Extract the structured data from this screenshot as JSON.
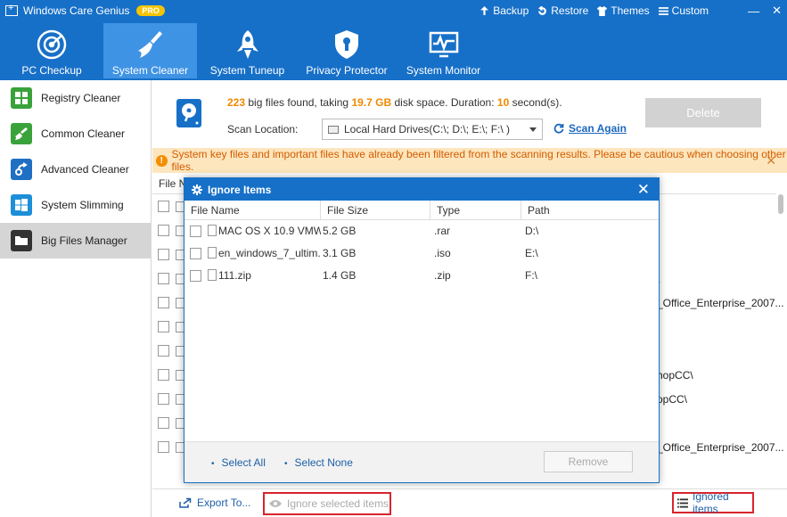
{
  "titlebar": {
    "app_name": "Windows Care Genius",
    "badge": "PRO",
    "actions": [
      "Backup",
      "Restore",
      "Themes",
      "Custom"
    ],
    "minimize": "—",
    "close": "✕"
  },
  "nav": {
    "tabs": [
      {
        "label": "PC Checkup",
        "icon": "radar-icon"
      },
      {
        "label": "System Cleaner",
        "icon": "broom-icon",
        "active": true
      },
      {
        "label": "System Tuneup",
        "icon": "rocket-icon"
      },
      {
        "label": "Privacy Protector",
        "icon": "shield-icon"
      },
      {
        "label": "System Monitor",
        "icon": "monitor-icon"
      }
    ]
  },
  "sidebar": {
    "items": [
      {
        "label": "Registry Cleaner",
        "icon": "registry-icon",
        "color": "#3aa23a"
      },
      {
        "label": "Common Cleaner",
        "icon": "broom-icon",
        "color": "#3aa23a"
      },
      {
        "label": "Advanced Cleaner",
        "icon": "advanced-icon",
        "color": "#1f6fc2"
      },
      {
        "label": "System Slimming",
        "icon": "windows-icon",
        "color": "#1d8fd8"
      },
      {
        "label": "Big Files Manager",
        "icon": "folder-icon",
        "color": "#333333",
        "active": true
      }
    ]
  },
  "scan": {
    "count": "223",
    "text1": " big files found, taking ",
    "size": "19.7 GB",
    "text2": " disk space. Duration: ",
    "duration": "10",
    "text3": " second(s).",
    "location_label": "Scan Location:",
    "location_value": "Local Hard Drives(C:\\; D:\\; E:\\; F:\\ )",
    "scan_again": "Scan Again",
    "delete": "Delete"
  },
  "warning": {
    "text": "System key files and important files have already been filtered from the scanning results. Please be cautious when choosing other files.",
    "close": "✕"
  },
  "bg_table": {
    "header": "File Na",
    "paths": [
      "",
      "",
      "",
      "\\",
      "_Office_Enterprise_2007...",
      "",
      "",
      "hopCC\\",
      "opCC\\",
      "",
      "_Office_Enterprise_2007..."
    ]
  },
  "bottom": {
    "export": "Export To...",
    "ignore_selected": "Ignore selected items",
    "ignored_items": "Ignored items"
  },
  "dialog": {
    "title": "Ignore Items",
    "close": "✕",
    "columns": [
      "File Name",
      "File Size",
      "Type",
      "Path"
    ],
    "rows": [
      {
        "name": "MAC OS X 10.9 VMW...",
        "size": "5.2 GB",
        "type": ".rar",
        "path": "D:\\"
      },
      {
        "name": "en_windows_7_ultim...",
        "size": "3.1 GB",
        "type": ".iso",
        "path": "E:\\"
      },
      {
        "name": "111.zip",
        "size": "1.4 GB",
        "type": ".zip",
        "path": "F:\\"
      }
    ],
    "select_all": "Select All",
    "select_none": "Select None",
    "remove": "Remove"
  }
}
